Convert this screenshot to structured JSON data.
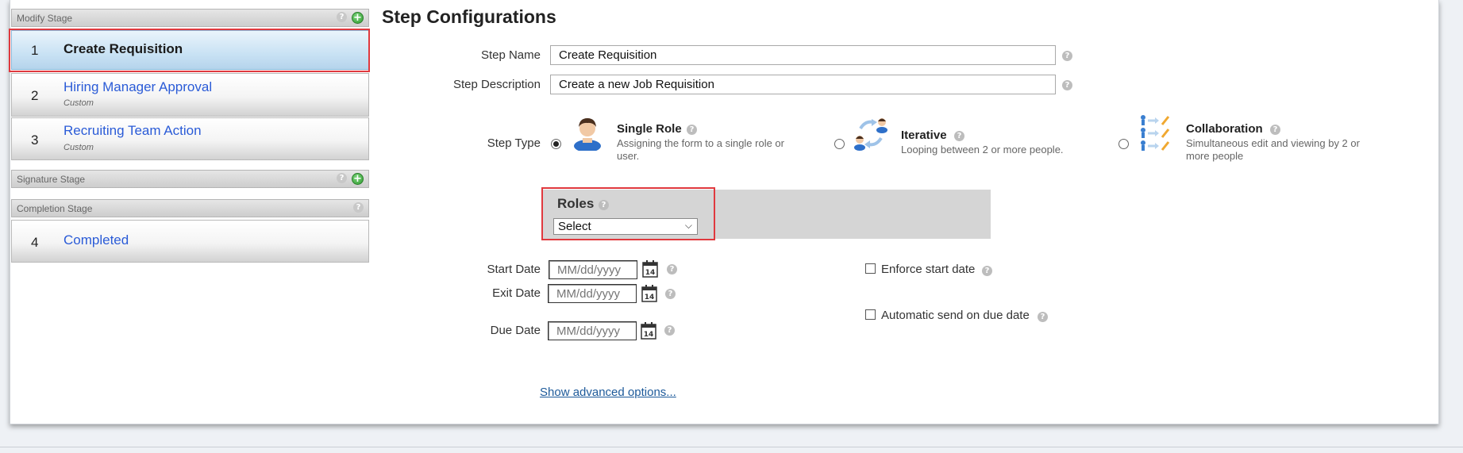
{
  "left_panel": {
    "modify_stage": {
      "label": "Modify Stage"
    },
    "signature_stage": {
      "label": "Signature Stage"
    },
    "completion_stage": {
      "label": "Completion Stage"
    },
    "steps": [
      {
        "number": "1",
        "title": "Create Requisition",
        "subtitle": "",
        "selected": true
      },
      {
        "number": "2",
        "title": "Hiring Manager Approval",
        "subtitle": "Custom",
        "selected": false
      },
      {
        "number": "3",
        "title": "Recruiting Team Action",
        "subtitle": "Custom",
        "selected": false
      },
      {
        "number": "4",
        "title": "Completed",
        "subtitle": "",
        "selected": false
      }
    ]
  },
  "config": {
    "title": "Step Configurations",
    "step_name": {
      "label": "Step Name",
      "value": "Create Requisition"
    },
    "step_description": {
      "label": "Step Description",
      "value": "Create a new Job Requisition"
    },
    "step_type": {
      "label": "Step Type",
      "options": [
        {
          "title": "Single Role",
          "desc": "Assigning the form to a single role or user.",
          "selected": true
        },
        {
          "title": "Iterative",
          "desc": "Looping between 2 or more people.",
          "selected": false
        },
        {
          "title": "Collaboration",
          "desc": "Simultaneous edit and viewing by 2 or more people",
          "selected": false
        }
      ]
    },
    "roles": {
      "label": "Roles",
      "selected": "Select"
    },
    "start_date": {
      "label": "Start Date",
      "placeholder": "MM/dd/yyyy"
    },
    "exit_date": {
      "label": "Exit Date",
      "placeholder": "MM/dd/yyyy"
    },
    "due_date": {
      "label": "Due Date",
      "placeholder": "MM/dd/yyyy"
    },
    "calendar_day": "14",
    "enforce_start_date": {
      "label": "Enforce start date",
      "checked": false
    },
    "automatic_send": {
      "label": "Automatic send on due date",
      "checked": false
    },
    "advanced_link": "Show advanced options..."
  },
  "icons": {
    "help": "question-circle-icon",
    "add": "plus-circle-icon",
    "calendar": "calendar-icon"
  },
  "colors": {
    "link": "#2a5bd7",
    "highlight_border": "#e0393e",
    "selected_step_bg": "#c9e2f4",
    "roles_panel_bg": "#d5d5d5"
  }
}
